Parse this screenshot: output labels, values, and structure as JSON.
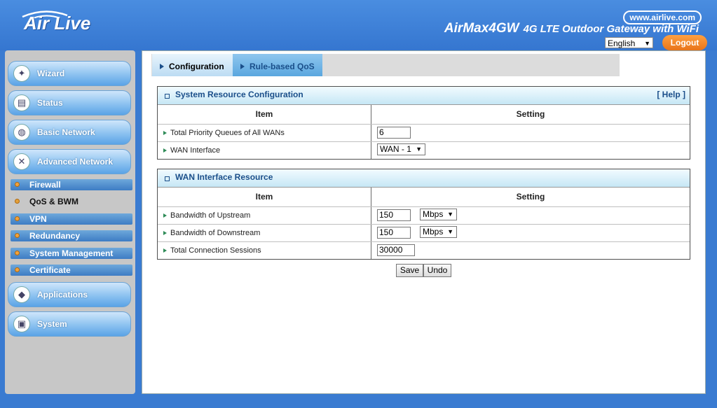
{
  "header": {
    "logo_alt": "Air Live",
    "site_url": "www.airlive.com",
    "product_model": "AirMax4GW",
    "product_desc": "4G LTE Outdoor Gateway with WiFi",
    "language": "English",
    "logout_label": "Logout"
  },
  "sidebar": {
    "main_items": [
      {
        "label": "Wizard",
        "icon": "wizard-wand-icon"
      },
      {
        "label": "Status",
        "icon": "status-chart-icon"
      },
      {
        "label": "Basic Network",
        "icon": "globe-icon"
      },
      {
        "label": "Advanced Network",
        "icon": "tools-icon"
      }
    ],
    "sub_items": [
      {
        "label": "Firewall"
      },
      {
        "label": "QoS & BWM",
        "active": true
      },
      {
        "label": "VPN"
      },
      {
        "label": "Redundancy"
      },
      {
        "label": "System Management"
      },
      {
        "label": "Certificate"
      }
    ],
    "bottom_items": [
      {
        "label": "Applications",
        "icon": "applications-icon"
      },
      {
        "label": "System",
        "icon": "system-icon"
      }
    ]
  },
  "tabs": [
    {
      "label": "Configuration",
      "active": true
    },
    {
      "label": "Rule-based QoS",
      "active": false
    }
  ],
  "system_resource": {
    "title": "System Resource Configuration",
    "help_label": "[ Help ]",
    "col_item": "Item",
    "col_setting": "Setting",
    "rows": [
      {
        "label": "Total Priority Queues of All WANs",
        "value": "6"
      },
      {
        "label": "WAN Interface",
        "value": "WAN - 1"
      }
    ]
  },
  "wan_resource": {
    "title": "WAN Interface Resource",
    "col_item": "Item",
    "col_setting": "Setting",
    "rows": [
      {
        "label": "Bandwidth of Upstream",
        "value": "150",
        "unit": "Mbps"
      },
      {
        "label": "Bandwidth of Downstream",
        "value": "150",
        "unit": "Mbps"
      },
      {
        "label": "Total Connection Sessions",
        "value": "30000"
      }
    ]
  },
  "buttons": {
    "save": "Save",
    "undo": "Undo"
  },
  "colors": {
    "background": "#3a7bd1",
    "accent_orange": "#e8741a",
    "title_blue": "#1b4f8a"
  }
}
